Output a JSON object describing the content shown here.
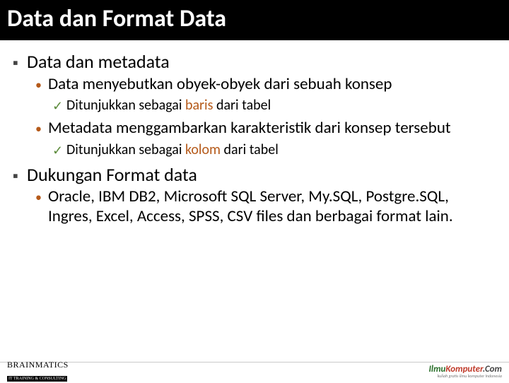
{
  "title": "Data dan Format Data",
  "sections": [
    {
      "heading": "Data dan metadata",
      "items": [
        {
          "text_pre": "Data menyebutkan obyek-obyek dari sebuah konsep",
          "sub_pre": "Ditunjukkan sebagai ",
          "sub_hl": "baris",
          "sub_post": " dari tabel"
        },
        {
          "text_pre": "Metadata menggambarkan karakteristik dari konsep tersebut",
          "sub_pre": "Ditunjukkan sebagai ",
          "sub_hl": "kolom",
          "sub_post": " dari tabel"
        }
      ]
    },
    {
      "heading": "Dukungan Format data",
      "items": [
        {
          "text_pre": "Oracle, IBM DB2, Microsoft SQL Server, My.SQL, Postgre.SQL, Ingres, Excel, Access, SPSS, CSV files dan berbagai format lain."
        }
      ]
    }
  ],
  "footer": {
    "left_brand_a": "BRAIN",
    "left_brand_b": "MATICS",
    "left_sub": "IT TRAINING & CONSULTING",
    "right_ilmu": "Ilmu",
    "right_komputer": "Komputer",
    "right_com": ".Com",
    "right_tag": "kuliah gratis ilmu komputer Indonesia"
  }
}
